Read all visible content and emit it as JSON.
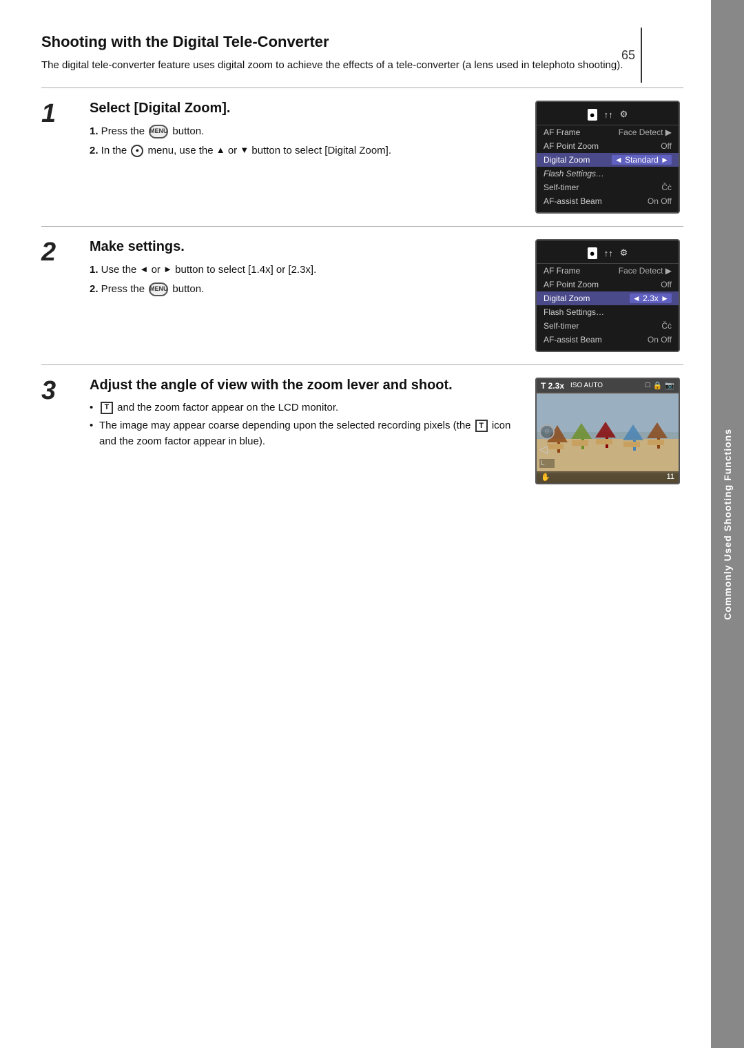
{
  "page": {
    "number": "65",
    "sidebar_label": "Commonly Used Shooting Functions"
  },
  "header": {
    "title": "Shooting with the Digital Tele-Converter",
    "intro": "The digital tele-converter feature uses digital zoom to achieve the effects of a tele-converter (a lens used in telephoto shooting)."
  },
  "steps": [
    {
      "number": "1",
      "heading": "Select [Digital Zoom].",
      "instructions": [
        "1. Press the  MENU  button.",
        "2. In the  ● menu, use the ▲ or ▼ button to select [Digital Zoom]."
      ],
      "menu": {
        "rows": [
          {
            "label": "AF Frame",
            "value": "Face Detect",
            "highlighted": false
          },
          {
            "label": "AF Point Zoom",
            "value": "Off",
            "highlighted": false
          },
          {
            "label": "Digital Zoom",
            "value": "◄ Standard ►",
            "highlighted": true
          },
          {
            "label": "Flash Settings…",
            "value": "",
            "highlighted": false
          },
          {
            "label": "Self-timer",
            "value": "Čċ",
            "highlighted": false
          },
          {
            "label": "AF-assist Beam",
            "value": "On Off",
            "highlighted": false
          }
        ]
      }
    },
    {
      "number": "2",
      "heading": "Make settings.",
      "instructions": [
        "1. Use the ◄ or ► button to select [1.4x] or [2.3x].",
        "2. Press the  MENU  button."
      ],
      "menu": {
        "rows": [
          {
            "label": "AF Frame",
            "value": "Face Detect",
            "highlighted": false
          },
          {
            "label": "AF Point Zoom",
            "value": "Off",
            "highlighted": false
          },
          {
            "label": "Digital Zoom",
            "value": "◄ 2.3x ►",
            "highlighted": true
          },
          {
            "label": "Flash Settings…",
            "value": "",
            "highlighted": false
          },
          {
            "label": "Self-timer",
            "value": "Čċ",
            "highlighted": false
          },
          {
            "label": "AF-assist Beam",
            "value": "On Off",
            "highlighted": false
          }
        ]
      }
    },
    {
      "number": "3",
      "heading": "Adjust the angle of view with the zoom lever and shoot.",
      "bullets": [
        "T  and the zoom factor appear on the LCD monitor.",
        "The image may appear coarse depending upon the selected recording pixels (the  T  icon and the zoom factor appear in blue)."
      ],
      "viewfinder": {
        "zoom": "T 2.3x",
        "iso": "ISO AUTO",
        "frame_count": "11"
      }
    }
  ]
}
